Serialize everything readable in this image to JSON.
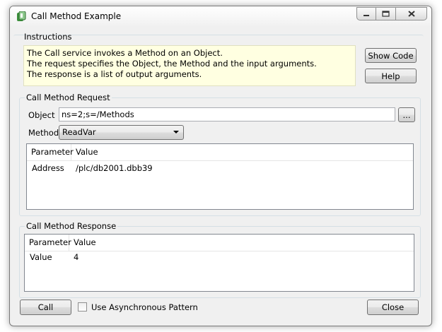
{
  "window": {
    "title": "Call Method Example"
  },
  "instructions": {
    "group_label": "Instructions",
    "lines": [
      "The Call service invokes a Method on an Object.",
      "The request specifies the Object, the Method and the input arguments.",
      "The response is a list of output arguments."
    ],
    "show_code_label": "Show Code",
    "help_label": "Help"
  },
  "request": {
    "group_label": "Call Method Request",
    "object_label": "Object",
    "object_value": "ns=2;s=/Methods",
    "browse_label": "...",
    "method_label": "Method",
    "method_value": "ReadVar",
    "columns": [
      "Parameter",
      "Value"
    ],
    "rows": [
      {
        "parameter": "Address",
        "value": "/plc/db2001.dbb39"
      }
    ]
  },
  "response": {
    "group_label": "Call Method Response",
    "columns": [
      "Parameter",
      "Value"
    ],
    "rows": [
      {
        "parameter": "Value",
        "value": "4"
      }
    ]
  },
  "footer": {
    "call_label": "Call",
    "async_label": "Use Asynchronous Pattern",
    "async_checked": false,
    "close_label": "Close"
  }
}
